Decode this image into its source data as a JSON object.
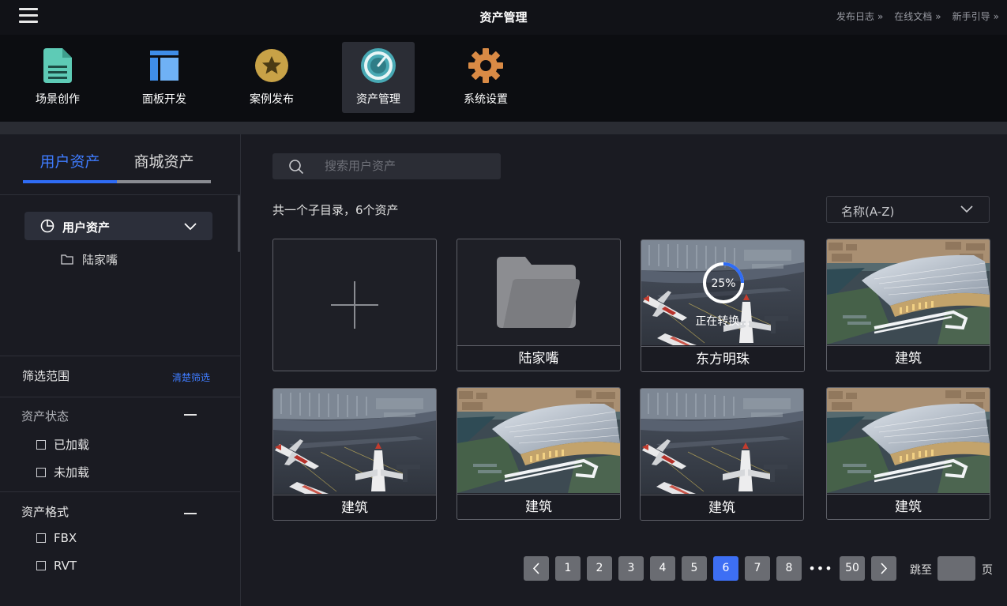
{
  "header": {
    "title": "资产管理",
    "links": [
      "发布日志",
      "在线文档",
      "新手引导"
    ]
  },
  "toolbar": {
    "items": [
      {
        "label": "场景创作",
        "icon": "document-icon",
        "color": "#5ecbb6"
      },
      {
        "label": "面板开发",
        "icon": "panel-layout-icon",
        "color": "#3f8de8"
      },
      {
        "label": "案例发布",
        "icon": "star-badge-icon",
        "color": "#c8a247"
      },
      {
        "label": "资产管理",
        "icon": "gauge-icon",
        "color": "#48a9b4",
        "active": true
      },
      {
        "label": "系统设置",
        "icon": "gear-icon",
        "color": "#d98a45"
      }
    ]
  },
  "sidebar": {
    "tabs": [
      "用户资产",
      "商城资产"
    ],
    "active_tab": "用户资产",
    "tree": {
      "root": "用户资产",
      "children": [
        "陆家嘴"
      ]
    },
    "filter": {
      "title": "筛选范围",
      "clear": "清楚筛选",
      "groups": [
        {
          "title": "资产状态",
          "options": [
            "已加载",
            "未加载"
          ]
        },
        {
          "title": "资产格式",
          "options": [
            "FBX",
            "RVT"
          ]
        }
      ]
    }
  },
  "main": {
    "search_placeholder": "搜索用户资产",
    "summary": "共一个子目录，6个资产",
    "sort": "名称(A-Z)",
    "cards": [
      {
        "type": "add",
        "name": ""
      },
      {
        "type": "folder",
        "name": "陆家嘴"
      },
      {
        "type": "converting",
        "name": "东方明珠",
        "progress": "25%",
        "status": "正在转换..."
      },
      {
        "type": "building",
        "name": "建筑"
      },
      {
        "type": "airport",
        "name": "建筑"
      },
      {
        "type": "building",
        "name": "建筑"
      },
      {
        "type": "airport",
        "name": "建筑"
      },
      {
        "type": "building",
        "name": "建筑"
      }
    ]
  },
  "pagination": {
    "pages": [
      "1",
      "2",
      "3",
      "4",
      "5",
      "6",
      "7",
      "8",
      "•••",
      "50"
    ],
    "current": "6",
    "jump_label": "跳至",
    "jump_unit": "页",
    "accent": "#3d6ff4"
  }
}
